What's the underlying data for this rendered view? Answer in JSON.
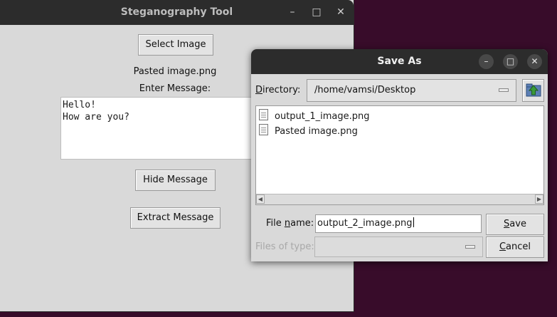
{
  "main_window": {
    "title": "Steganography Tool",
    "select_button": "Select Image",
    "filename_label": "Pasted image.png",
    "enter_message_label": "Enter Message:",
    "message_text": "Hello!\nHow are you?",
    "hide_button": "Hide Message",
    "extract_button": "Extract Message",
    "controls": {
      "minimize": "–",
      "maximize": "□",
      "close": "✕"
    }
  },
  "save_dialog": {
    "title": "Save As",
    "directory_label_pre": "D",
    "directory_label_post": "irectory:",
    "directory_value": "/home/vamsi/Desktop",
    "files": [
      "output_1_image.png",
      "Pasted image.png"
    ],
    "file_name_label_pre": "File ",
    "file_name_label_ul": "n",
    "file_name_label_post": "ame:",
    "file_name_value": "output_2_image.png",
    "files_of_type_label": "Files of type:",
    "save_button_ul": "S",
    "save_button_rest": "ave",
    "cancel_button_ul": "C",
    "cancel_button_rest": "ancel",
    "controls": {
      "minimize": "–",
      "maximize": "□",
      "close": "✕"
    }
  },
  "colors": {
    "desktop": "#380c2a",
    "titlebar": "#2c2c2c",
    "window_bg": "#d9d9d9",
    "folder_up_icon": "#3a9a3a"
  },
  "icons": [
    "file-icon",
    "folder-up-icon",
    "minimize-icon",
    "maximize-icon",
    "close-icon"
  ]
}
